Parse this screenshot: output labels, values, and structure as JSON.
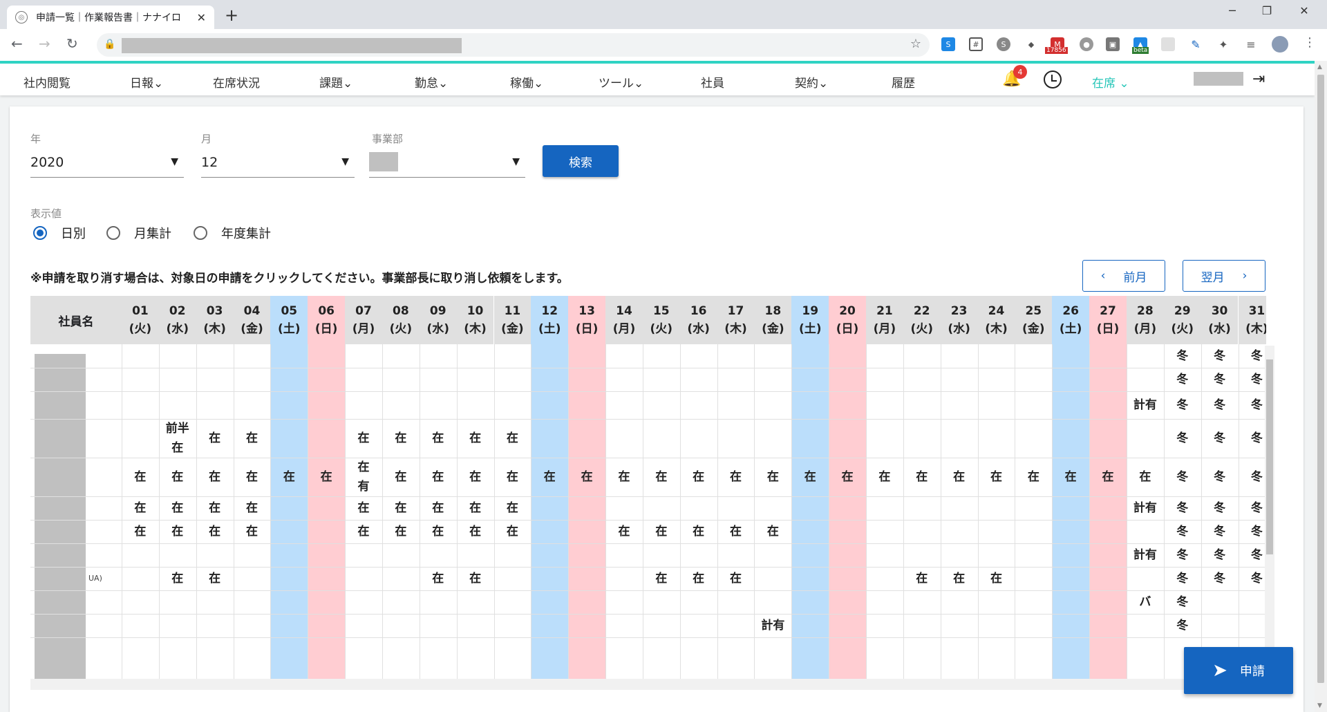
{
  "browser": {
    "tab_title": "申請一覧｜作業報告書｜ナナイロ",
    "tab_close": "✕",
    "new_tab": "+",
    "minimize": "─",
    "restore": "❐",
    "close": "✕",
    "ext_badge_count": "17856",
    "ext_badge_beta": "beta"
  },
  "nav": {
    "items": [
      "社内閲覧",
      "日報⌄",
      "在席状況",
      "課題⌄",
      "勤怠⌄",
      "稼働⌄",
      "ツール⌄",
      "社員",
      "契約⌄",
      "履歴"
    ],
    "notification_count": "4",
    "status": "在席 ⌄"
  },
  "filters": {
    "year_label": "年",
    "year_value": "2020",
    "month_label": "月",
    "month_value": "12",
    "dept_label": "事業部",
    "search_button": "検索"
  },
  "display": {
    "label": "表示値",
    "options": [
      "日別",
      "月集計",
      "年度集計"
    ],
    "selected": 0
  },
  "notice": "※申請を取り消す場合は、対象日の申請をクリックしてください。事業部長に取り消し依頼をします。",
  "pager": {
    "prev": "前月",
    "next": "翌月"
  },
  "table": {
    "name_header": "社員名",
    "days": [
      {
        "d": "01",
        "w": "(火)"
      },
      {
        "d": "02",
        "w": "(水)"
      },
      {
        "d": "03",
        "w": "(木)"
      },
      {
        "d": "04",
        "w": "(金)"
      },
      {
        "d": "05",
        "w": "(土)"
      },
      {
        "d": "06",
        "w": "(日)"
      },
      {
        "d": "07",
        "w": "(月)"
      },
      {
        "d": "08",
        "w": "(火)"
      },
      {
        "d": "09",
        "w": "(水)"
      },
      {
        "d": "10",
        "w": "(木)"
      },
      {
        "d": "11",
        "w": "(金)"
      },
      {
        "d": "12",
        "w": "(土)"
      },
      {
        "d": "13",
        "w": "(日)"
      },
      {
        "d": "14",
        "w": "(月)"
      },
      {
        "d": "15",
        "w": "(火)"
      },
      {
        "d": "16",
        "w": "(水)"
      },
      {
        "d": "17",
        "w": "(木)"
      },
      {
        "d": "18",
        "w": "(金)"
      },
      {
        "d": "19",
        "w": "(土)"
      },
      {
        "d": "20",
        "w": "(日)"
      },
      {
        "d": "21",
        "w": "(月)"
      },
      {
        "d": "22",
        "w": "(火)"
      },
      {
        "d": "23",
        "w": "(水)"
      },
      {
        "d": "24",
        "w": "(木)"
      },
      {
        "d": "25",
        "w": "(金)"
      },
      {
        "d": "26",
        "w": "(土)"
      },
      {
        "d": "27",
        "w": "(日)"
      },
      {
        "d": "28",
        "w": "(月)"
      },
      {
        "d": "29",
        "w": "(火)"
      },
      {
        "d": "30",
        "w": "(水)"
      },
      {
        "d": "31",
        "w": "(木)"
      }
    ],
    "rows": [
      {
        "cells": {
          "29": "冬",
          "30": "冬",
          "31": "冬"
        }
      },
      {
        "cells": {
          "29": "冬",
          "30": "冬",
          "31": "冬"
        }
      },
      {
        "cells": {
          "28": "計有",
          "29": "冬",
          "30": "冬",
          "31": "冬"
        }
      },
      {
        "cells": {
          "02": "前半\n在",
          "03": "在",
          "04": "在",
          "07": "在",
          "08": "在",
          "09": "在",
          "10": "在",
          "11": "在",
          "29": "冬",
          "30": "冬",
          "31": "冬"
        }
      },
      {
        "cells": {
          "01": "在",
          "02": "在",
          "03": "在",
          "04": "在",
          "05": "在",
          "06": "在",
          "07": "在\n有",
          "08": "在",
          "09": "在",
          "10": "在",
          "11": "在",
          "12": "在",
          "13": "在",
          "14": "在",
          "15": "在",
          "16": "在",
          "17": "在",
          "18": "在",
          "19": "在",
          "20": "在",
          "21": "在",
          "22": "在",
          "23": "在",
          "24": "在",
          "25": "在",
          "26": "在",
          "27": "在",
          "28": "在",
          "29": "冬",
          "30": "冬",
          "31": "冬"
        }
      },
      {
        "cells": {
          "01": "在",
          "02": "在",
          "03": "在",
          "04": "在",
          "07": "在",
          "08": "在",
          "09": "在",
          "10": "在",
          "11": "在",
          "28": "計有",
          "29": "冬",
          "30": "冬",
          "31": "冬"
        }
      },
      {
        "cells": {
          "01": "在",
          "02": "在",
          "03": "在",
          "04": "在",
          "07": "在",
          "08": "在",
          "09": "在",
          "10": "在",
          "11": "在",
          "14": "在",
          "15": "在",
          "16": "在",
          "17": "在",
          "18": "在",
          "29": "冬",
          "30": "冬",
          "31": "冬"
        }
      },
      {
        "cells": {
          "28": "計有",
          "29": "冬",
          "30": "冬",
          "31": "冬"
        }
      },
      {
        "name_tail": "UA)",
        "cells": {
          "02": "在",
          "03": "在",
          "09": "在",
          "10": "在",
          "15": "在",
          "16": "在",
          "17": "在",
          "22": "在",
          "23": "在",
          "24": "在",
          "29": "冬",
          "30": "冬",
          "31": "冬"
        }
      },
      {
        "cells": {
          "28": "バ",
          "29": "冬"
        }
      },
      {
        "cells": {
          "18": "計有",
          "29": "冬"
        }
      }
    ]
  },
  "fab": {
    "label": "申請"
  }
}
